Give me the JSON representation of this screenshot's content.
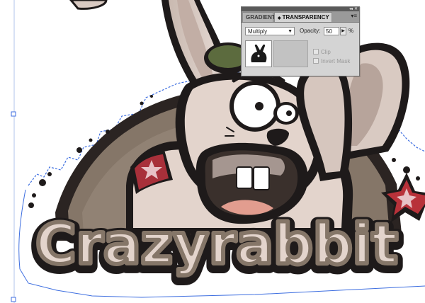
{
  "panel": {
    "tabs": [
      {
        "label": "GRADIENT",
        "active": false
      },
      {
        "label": "TRANSPARENCY",
        "active": true
      }
    ],
    "menu_icon": "panel-menu-icon",
    "blend_mode": "Multiply",
    "opacity_label": "Opacity:",
    "opacity_value": "50",
    "opacity_unit": "%",
    "clip_label": "Clip",
    "invert_mask_label": "Invert Mask"
  },
  "artwork": {
    "logo_text": "Crazyrabbit"
  },
  "colors": {
    "panel_bg": "#d4d4d4",
    "panel_titlebar": "#5a5a5a",
    "selection_path": "#3d6ee0",
    "fur": "#e3d4cc",
    "dark_outline": "#1e1a1a",
    "hill": "#857668",
    "star": "#b8323a",
    "hat": "#5c6b3e"
  }
}
